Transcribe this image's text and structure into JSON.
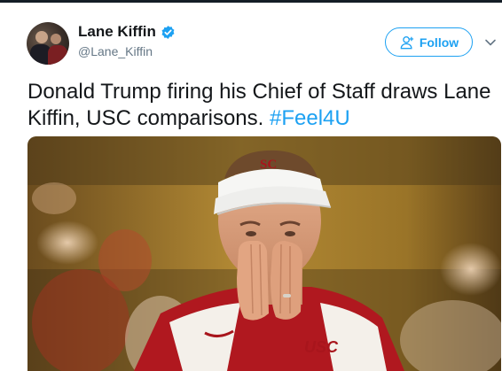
{
  "user": {
    "display_name": "Lane Kiffin",
    "handle": "@Lane_Kiffin",
    "verified": true
  },
  "actions": {
    "follow_label": "Follow",
    "menu_icon": "chevron-down-icon"
  },
  "tweet": {
    "text": "Donald Trump firing his Chief of Staff draws Lane Kiffin, USC comparisons.",
    "hashtag": "#Feel4U"
  },
  "media": {
    "visor_logo": "SC",
    "jersey_text": "USC"
  },
  "colors": {
    "accent": "#1da1f2",
    "text": "#14171a",
    "secondary": "#657786"
  }
}
